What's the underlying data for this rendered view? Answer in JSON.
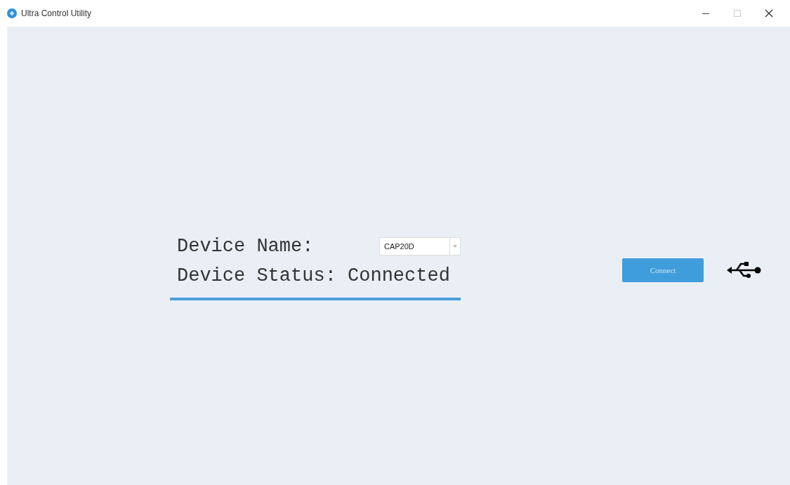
{
  "window": {
    "title": "Ultra Control Utility"
  },
  "device": {
    "name_label": "Device Name:",
    "selected_device": "CAP20D",
    "status_text": "Device Status: Connected"
  },
  "connect_button": {
    "label": "Connect",
    "disabled": true
  }
}
